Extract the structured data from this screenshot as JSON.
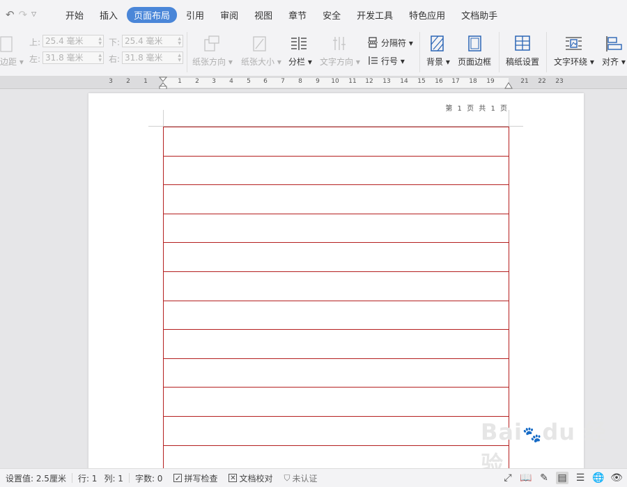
{
  "menubar": {
    "tabs": [
      "开始",
      "插入",
      "页面布局",
      "引用",
      "审阅",
      "视图",
      "章节",
      "安全",
      "开发工具",
      "特色应用",
      "文档助手"
    ],
    "active_tab": "页面布局"
  },
  "ribbon": {
    "margins_label": "边距",
    "top_label": "上:",
    "top_value": "25.4 毫米",
    "bottom_label": "下:",
    "bottom_value": "25.4 毫米",
    "left_label": "左:",
    "left_value": "31.8 毫米",
    "right_label": "右:",
    "right_value": "31.8 毫米",
    "orientation": "纸张方向",
    "paper_size": "纸张大小",
    "columns": "分栏",
    "text_direction": "文字方向",
    "separator": "分隔符",
    "line_number": "行号",
    "background": "背景",
    "page_border": "页面边框",
    "paper_setup": "稿纸设置",
    "text_wrap": "文字环绕",
    "align": "对齐"
  },
  "ruler": {
    "numbers": [
      "3",
      "2",
      "1",
      "1",
      "2",
      "3",
      "4",
      "5",
      "6",
      "7",
      "8",
      "9",
      "10",
      "11",
      "12",
      "13",
      "14",
      "15",
      "16",
      "17",
      "18",
      "19",
      "21",
      "22",
      "23"
    ]
  },
  "document": {
    "header_text": "第 1 页 共 1 页"
  },
  "watermark": {
    "text": "Bai du 经验",
    "url": "jingyan.baidu.com"
  },
  "status": {
    "setting": "设置值: 2.5厘米",
    "row": "行: 1",
    "col": "列: 1",
    "word_count": "字数: 0",
    "spell_check": "拼写检查",
    "doc_check": "文档校对",
    "uncertified": "未认证"
  },
  "colors": {
    "accent": "#4a86d8",
    "grid_line": "#b41e1e"
  }
}
